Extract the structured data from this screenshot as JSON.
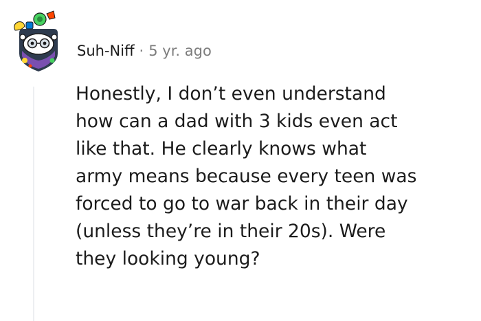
{
  "comment": {
    "author": "Suh-Niff",
    "separator": "·",
    "timestamp": "5 yr. ago",
    "avatar_icon": "snoo-avatar-icon",
    "body_lines": [
      "Honestly, I don’t even understand",
      "how can a dad with 3 kids even act",
      "like that. He clearly knows what",
      "army means because every teen was",
      "forced to go to war back in their day",
      "(unless they’re in their 20s). Were",
      "they looking young?"
    ]
  },
  "colors": {
    "text": "#1c1c1c",
    "meta_text": "#7c7c7c",
    "thread_line": "#edeff1",
    "avatar_dark": "#2e3b4e",
    "avatar_accent_green": "#46d160",
    "avatar_accent_red": "#ff4500",
    "avatar_accent_yellow": "#ffd635"
  }
}
